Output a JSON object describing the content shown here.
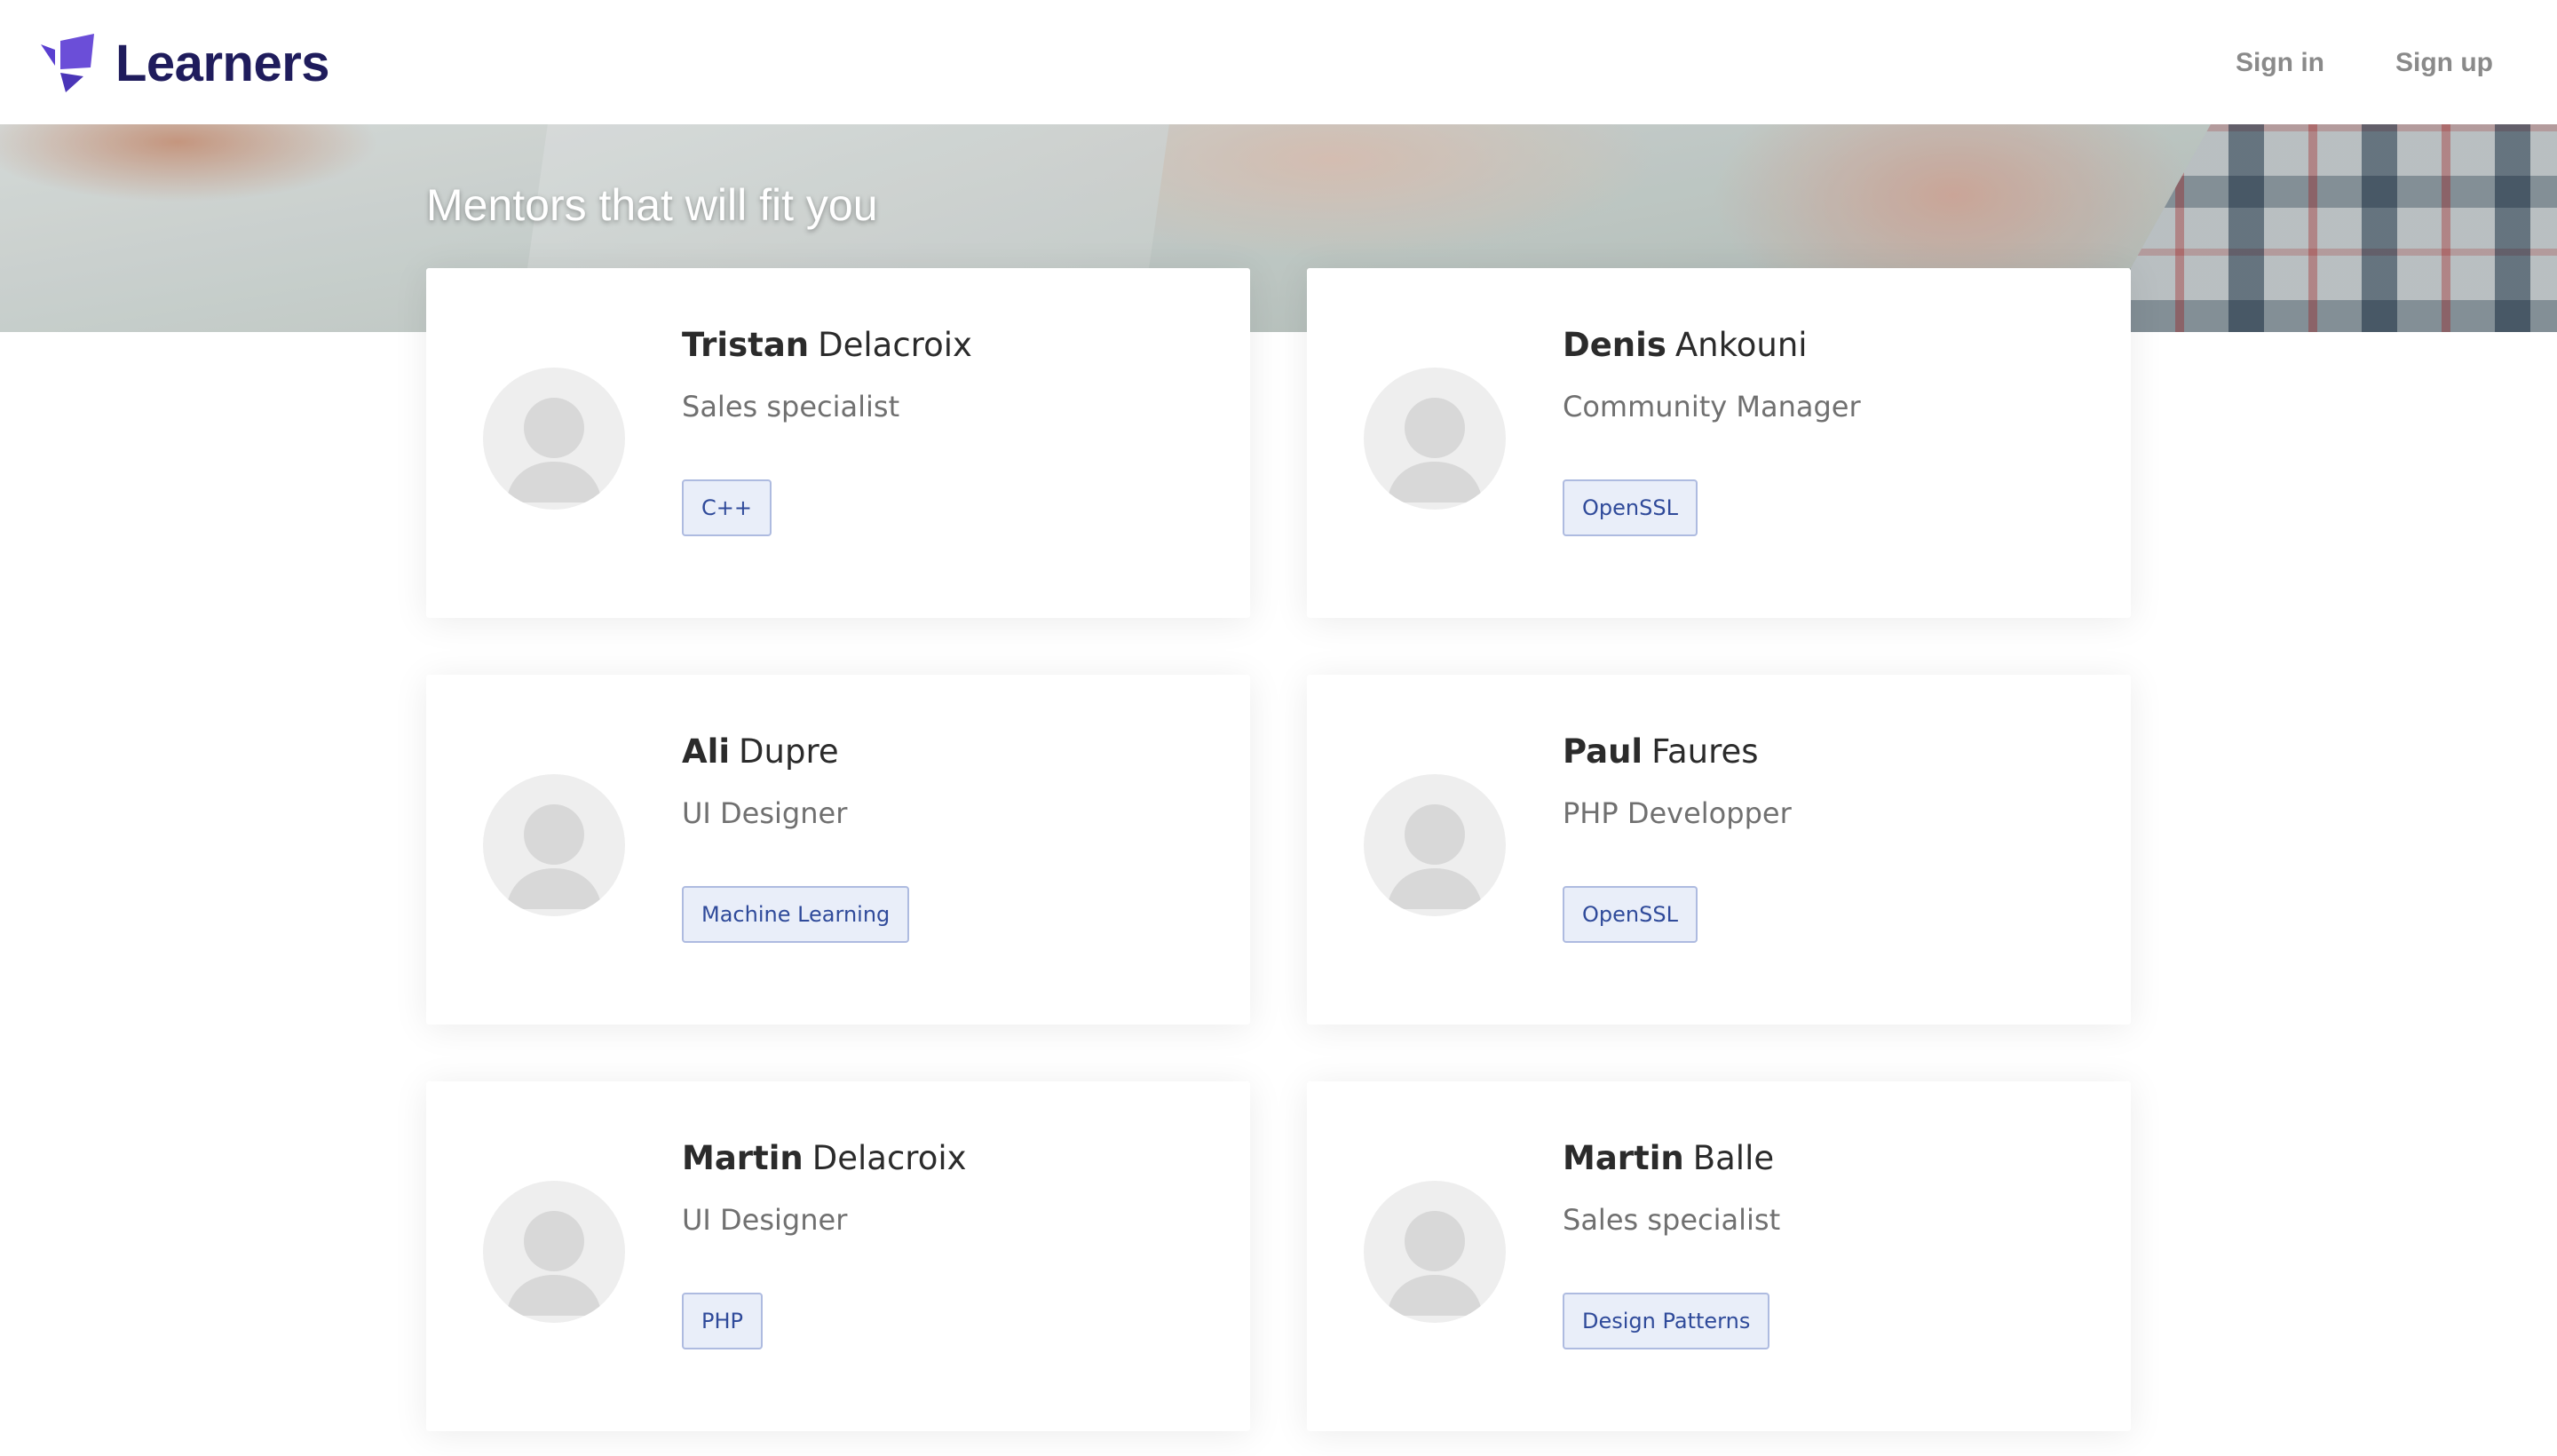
{
  "header": {
    "brand": "Learners",
    "nav": {
      "sign_in": "Sign in",
      "sign_up": "Sign up"
    }
  },
  "hero": {
    "title": "Mentors that will fit you"
  },
  "mentors": [
    {
      "first_name": "Tristan",
      "last_name": "Delacroix",
      "role": "Sales specialist",
      "tag": "C++"
    },
    {
      "first_name": "Denis",
      "last_name": "Ankouni",
      "role": "Community Manager",
      "tag": "OpenSSL"
    },
    {
      "first_name": "Ali",
      "last_name": "Dupre",
      "role": "UI Designer",
      "tag": "Machine Learning"
    },
    {
      "first_name": "Paul",
      "last_name": "Faures",
      "role": "PHP Developper",
      "tag": "OpenSSL"
    },
    {
      "first_name": "Martin",
      "last_name": "Delacroix",
      "role": "UI Designer",
      "tag": "PHP"
    },
    {
      "first_name": "Martin",
      "last_name": "Balle",
      "role": "Sales specialist",
      "tag": "Design Patterns"
    }
  ],
  "colors": {
    "brand": "#1f1c5c",
    "brand_accent": "#6b4ed8",
    "tag_text": "#2f4a9a",
    "tag_bg": "#e9eef9",
    "tag_border": "#aebbe0"
  },
  "icons": {
    "logo": "learners-logo-icon",
    "avatar": "user-placeholder-icon"
  }
}
